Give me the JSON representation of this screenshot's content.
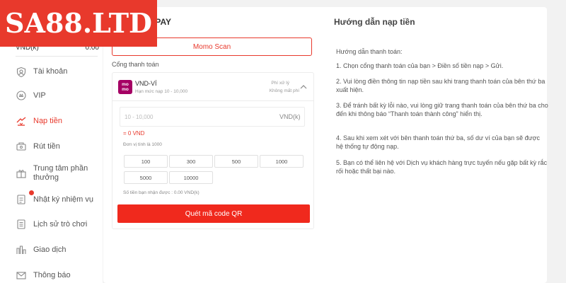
{
  "logo": {
    "text": "SA88.LTD"
  },
  "tab": {
    "title": "OPAY"
  },
  "balance": {
    "currency": "VND(k)",
    "amount": "0.00"
  },
  "sidebar": {
    "items": [
      {
        "label": "Tài khoản",
        "icon": "user-icon",
        "active": false
      },
      {
        "label": "VIP",
        "icon": "vip-icon",
        "active": false
      },
      {
        "label": "Nạp tiền",
        "icon": "deposit-icon",
        "active": true
      },
      {
        "label": "Rút tiền",
        "icon": "withdraw-icon",
        "active": false
      },
      {
        "label": "Trung tâm phần thưởng",
        "icon": "gift-icon",
        "active": false
      },
      {
        "label": "Nhật ký nhiệm vụ",
        "icon": "task-log-icon",
        "active": false,
        "badge": true
      },
      {
        "label": "Lịch sử trò chơi",
        "icon": "game-history-icon",
        "active": false
      },
      {
        "label": "Giao dịch",
        "icon": "transaction-icon",
        "active": false
      },
      {
        "label": "Thông báo",
        "icon": "mail-icon",
        "active": false
      }
    ]
  },
  "deposit": {
    "momo_scan_label": "Momo Scan",
    "gateway_label": "Cổng thanh toán",
    "method": {
      "logo_text": "mo mo",
      "name": "VND-VÍ",
      "limit": "Hạn mức nạp 10 - 10,000",
      "fee_label": "Phí xử lý",
      "fee_value": "Không mất phí"
    },
    "amount_placeholder": "10 - 10,000",
    "unit": "VND(k)",
    "equals": "= 0 VND",
    "unit_note": "Đơn vị tính là 1000",
    "quick_amounts": [
      "100",
      "300",
      "500",
      "1000",
      "5000",
      "10000"
    ],
    "received_note": "Số tiền bạn nhận được : 0.00 VND(k)",
    "qr_button": "Quét mã code QR"
  },
  "guide": {
    "title": "Hướng dẫn nạp tiền",
    "lines": [
      "Hướng dẫn thanh toán:",
      "1. Chọn cổng thanh toán của bạn > Điền số tiền nạp > Gửi.",
      "2. Vui lòng điền thông tin nạp tiền sau khi trang thanh toán của bên thứ ba xuất hiện.",
      "3. Để tránh bất kỳ lỗi nào, vui lòng giữ trang thanh toán của bên thứ ba cho đến khi thông báo “Thanh toán thành công” hiển thị.",
      "4. Sau khi xem xét với bên thanh toán thứ ba, số dư ví của bạn sẽ được hệ thống tự động nạp.",
      "5. Bạn có thể liên hệ với Dịch vụ khách hàng trực tuyến nếu gặp bất kỳ rắc rối hoặc thất bại nào."
    ]
  },
  "colors": {
    "accent": "#e8392c",
    "button": "#f0291d",
    "momo": "#a50064"
  }
}
